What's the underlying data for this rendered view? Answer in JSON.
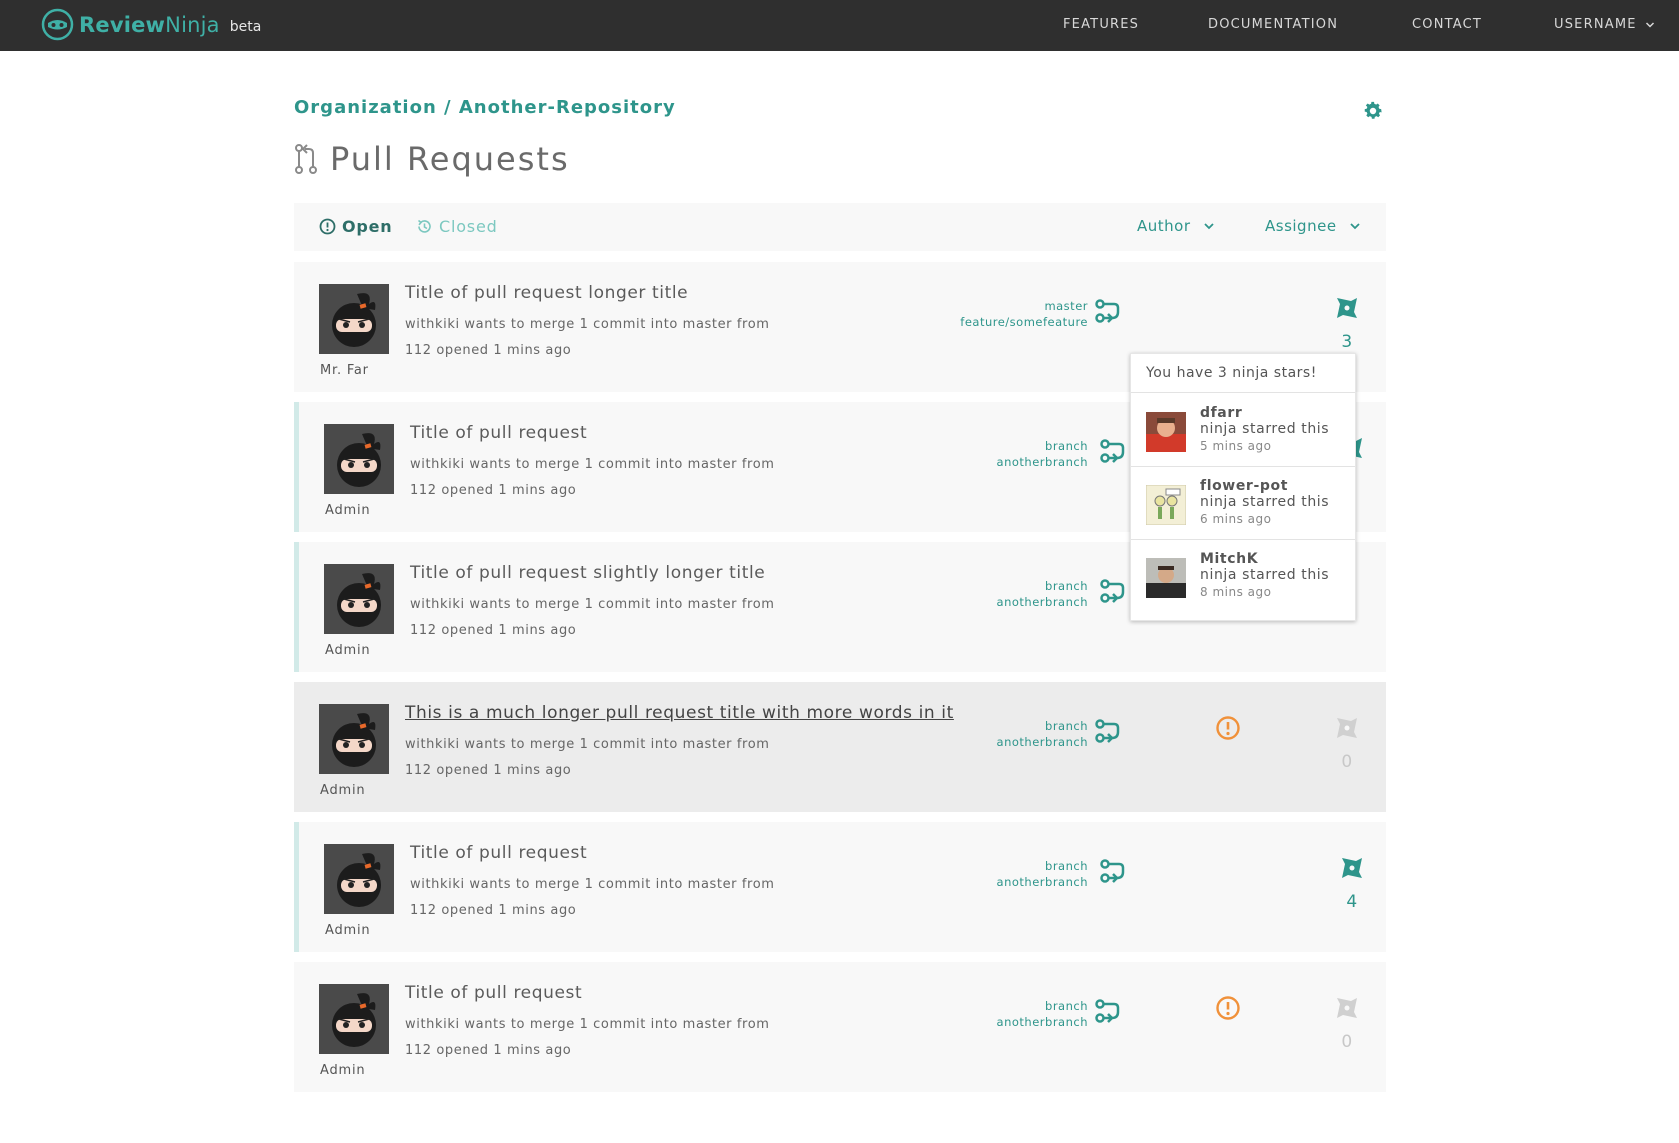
{
  "app": {
    "logo_text_a": "Review",
    "logo_text_b": "Ninja",
    "beta": "beta"
  },
  "nav": {
    "features": "FEATURES",
    "documentation": "DOCUMENTATION",
    "contact": "CONTACT",
    "username": "USERNAME"
  },
  "breadcrumb": "Organization / Another-Repository",
  "page_title": "Pull Requests",
  "filters": {
    "open": "Open",
    "closed": "Closed",
    "author": "Author",
    "assignee": "Assignee"
  },
  "pull_requests": [
    {
      "title": "Title of pull request longer title",
      "description": "withkiki wants to merge 1 commit into master from",
      "meta": "112 opened 1 mins ago",
      "author": "Mr. Far",
      "base": "master",
      "head": "feature/somefeature",
      "stars": "3",
      "warning": false
    },
    {
      "title": "Title of pull request",
      "description": "withkiki wants to merge 1 commit into master from",
      "meta": "112 opened 1 mins ago",
      "author": "Admin",
      "base": "branch",
      "head": "anotherbranch",
      "stars": "",
      "warning": false
    },
    {
      "title": "Title of pull request slightly longer title",
      "description": "withkiki wants to merge 1 commit into master from",
      "meta": "112 opened 1 mins ago",
      "author": "Admin",
      "base": "branch",
      "head": "anotherbranch",
      "stars": "",
      "warning": false
    },
    {
      "title": "This is a much longer pull request title with more words in it",
      "description": "withkiki wants to merge 1 commit into master from",
      "meta": "112 opened 1 mins ago",
      "author": "Admin",
      "base": "branch",
      "head": "anotherbranch",
      "stars": "0",
      "warning": true
    },
    {
      "title": "Title of pull request",
      "description": "withkiki wants to merge 1 commit into master from",
      "meta": "112 opened 1 mins ago",
      "author": "Admin",
      "base": "branch",
      "head": "anotherbranch",
      "stars": "4",
      "warning": false
    },
    {
      "title": "Title of pull request",
      "description": "withkiki wants to merge 1 commit into master from",
      "meta": "112 opened 1 mins ago",
      "author": "Admin",
      "base": "branch",
      "head": "anotherbranch",
      "stars": "0",
      "warning": true
    }
  ],
  "popover": {
    "header": "You have 3 ninja stars!",
    "items": [
      {
        "name": "dfarr",
        "text": "ninja starred this",
        "time": "5 mins ago"
      },
      {
        "name": "flower-pot",
        "text": "ninja starred this",
        "time": "6 mins ago"
      },
      {
        "name": "MitchK",
        "text": "ninja starred this",
        "time": "8 mins ago"
      }
    ]
  },
  "colors": {
    "accent": "#2e958b",
    "topbar": "#2f2f2f",
    "warning": "#f0913a",
    "star_inactive": "#c8c8c8"
  },
  "icons": [
    "logo-icon",
    "settings-gear-icon",
    "pull-request-icon",
    "open-issue-icon",
    "closed-history-icon",
    "chevron-down-icon",
    "merge-branch-icon",
    "warning-icon",
    "ninja-star-icon"
  ]
}
